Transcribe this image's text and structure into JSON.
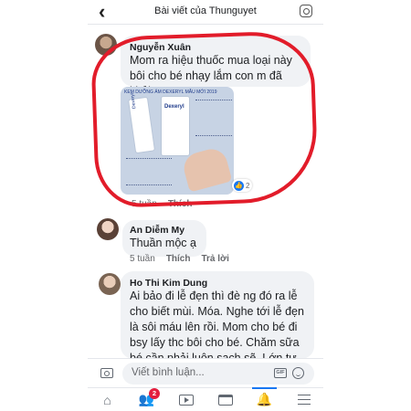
{
  "header": {
    "back_icon": "back-arrow-icon",
    "title": "Bài viết của Thunguyet",
    "right_icon": "instagram-icon"
  },
  "comments": [
    {
      "author": "Nguyễn Xuân",
      "text": "Mom ra hiệu thuốc mua loại này bôi cho bé nhạy lắm con m đã khỏi",
      "attachment": {
        "type": "photo",
        "caption": "KEM DƯỠNG ẨM DEXERYL MẪU MỚI 2019",
        "brand": "Dexeryl"
      },
      "reactions": {
        "icon": "like-icon",
        "count": "2"
      },
      "time": "5 tuần",
      "like_label": "Thích",
      "reply_label": ""
    },
    {
      "author": "An Diễm My",
      "text": "Thuần mộc ạ",
      "time": "5 tuần",
      "like_label": "Thích",
      "reply_label": "Trả lời"
    },
    {
      "author": "Ho Thi Kim Dung",
      "text": "Ai bảo đi lễ đẹn thì đè ng đó ra lễ cho biết mùi. Móa. Nghe tới lễ đẹn là sôi máu lên rồi. Mom cho bé đi bsy lấy thc bôi cho bé. Chăm sữa bé cần phải luôn sạch sẽ. Lớn tự hết nhé"
    }
  ],
  "composer": {
    "placeholder": "Viết bình luận...",
    "camera_icon": "camera-icon",
    "gif_label": "GIF",
    "emoji_icon": "emoji-icon"
  },
  "tabbar": {
    "tabs": [
      {
        "icon": "home-icon"
      },
      {
        "icon": "friends-icon",
        "badge": "2"
      },
      {
        "icon": "watch-icon"
      },
      {
        "icon": "marketplace-icon"
      },
      {
        "icon": "notifications-icon",
        "active": true
      },
      {
        "icon": "menu-icon"
      }
    ]
  },
  "colors": {
    "accent": "#1877f2",
    "annotation_circle": "#e21c2a",
    "badge": "#e41e3f",
    "bubble": "#f0f2f5"
  }
}
